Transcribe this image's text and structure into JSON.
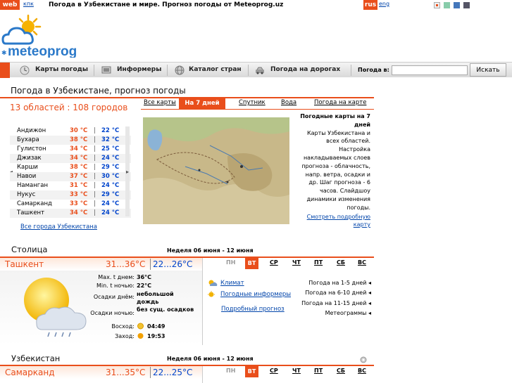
{
  "topbar": {
    "lang_web": "web",
    "lang_kpk": "кпк",
    "title": "Погода в Узбекистане и мире. Прогноз погоды от Meteoprog.uz",
    "lang_rus": "rus",
    "lang_eng": "eng",
    "theme_colors": [
      "#f0f0f0",
      "#88ccaa",
      "#4477bb",
      "#555566"
    ]
  },
  "logo": {
    "text": "meteoprog"
  },
  "nav": {
    "items": [
      {
        "label": "Карты погоды",
        "icon": "clock-icon"
      },
      {
        "label": "Информеры",
        "icon": "monitor-icon"
      },
      {
        "label": "Каталог стран",
        "icon": "globe-icon"
      },
      {
        "label": "Погода на дорогах",
        "icon": "car-icon"
      }
    ],
    "search_label": "Погода в:",
    "search_value": "",
    "search_button": "Искать"
  },
  "page_title": "Погода в Узбекистане, прогноз погоды",
  "regions": {
    "title": "13 областей : 108 городов",
    "cities": [
      {
        "name": "Андижон",
        "t1": "30 °C",
        "t2": "22 °C"
      },
      {
        "name": "Бухара",
        "t1": "38 °C",
        "t2": "32 °C"
      },
      {
        "name": "Гулистон",
        "t1": "34 °C",
        "t2": "25 °C"
      },
      {
        "name": "Джизак",
        "t1": "34 °C",
        "t2": "24 °C"
      },
      {
        "name": "Карши",
        "t1": "38 °C",
        "t2": "29 °C"
      },
      {
        "name": "Навои",
        "t1": "37 °C",
        "t2": "30 °C"
      },
      {
        "name": "Наманган",
        "t1": "31 °C",
        "t2": "24 °C"
      },
      {
        "name": "Нукус",
        "t1": "33 °C",
        "t2": "29 °C"
      },
      {
        "name": "Самарканд",
        "t1": "33 °C",
        "t2": "24 °C"
      },
      {
        "name": "Ташкент",
        "t1": "34 °C",
        "t2": "24 °C"
      }
    ],
    "separator": "|",
    "all_link": "Все города Узбекистана"
  },
  "maps": {
    "tabs": [
      "Все карты",
      "На 7 дней",
      "Спутник",
      "Вода",
      "Погода на карте"
    ],
    "active_tab": 1,
    "desc_title": "Погодные карты на 7 дней",
    "desc_body": "Карты Узбекистана и всех областей. Настройка накладываемых слоев прогноза - облачность, напр. ветра, осадки и др. Шаг прогноза - 6 часов. Слайдшоу динамики изменения погоды.",
    "more_link": "Смотреть подробную карту"
  },
  "capital": {
    "section_title": "Столица",
    "week": "Неделя 06 июня - 12 июня",
    "city": "Ташкент",
    "temp_day": "31...36°C",
    "temp_night": "22...26°C",
    "rows": [
      {
        "label": "Max. t днем:",
        "value": "36°C"
      },
      {
        "label": "Min. t ночью:",
        "value": "22°C"
      },
      {
        "label": "Осадки днём:",
        "value": "небольшой дождь"
      },
      {
        "label": "Осадки ночью:",
        "value": "без сущ. осадков"
      },
      {
        "label": "Восход:",
        "value": "04:49"
      },
      {
        "label": "Заход:",
        "value": "19:53"
      }
    ],
    "days": [
      "ПН",
      "ВТ",
      "СР",
      "ЧТ",
      "ПТ",
      "СБ",
      "ВС"
    ],
    "active_day": 1,
    "link_climate": "Климат",
    "link_informers": "Погодные информеры",
    "link_detailed": "Подробный прогноз",
    "right_links": [
      "Погода на 1-5 дней",
      "Погода на 6-10 дней",
      "Погода на 11-15 дней",
      "Метеограммы"
    ]
  },
  "country": {
    "section_title": "Узбекистан",
    "week": "Неделя 06 июня - 12 июня",
    "city": "Самарканд",
    "temp_day": "31...35°C",
    "temp_night": "22...25°C",
    "days": [
      "ПН",
      "ВТ",
      "СР",
      "ЧТ",
      "ПТ",
      "СБ",
      "ВС"
    ],
    "active_day": 1
  }
}
